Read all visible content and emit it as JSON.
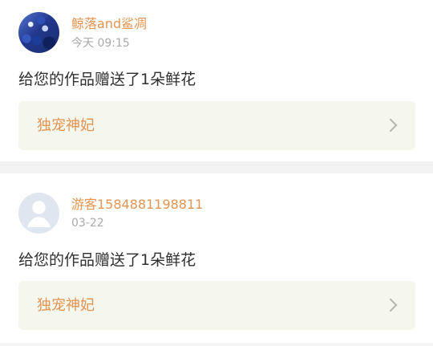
{
  "items": [
    {
      "username": "鲸落and鲨凋",
      "time": "今天 09:15",
      "message": "给您的作品赠送了1朵鲜花",
      "work_title": "独宠神妃",
      "avatar_icon": "user-photo-avatar",
      "arrow_icon": "chevron-right"
    },
    {
      "username": "游客1584881198811",
      "time": "03-22",
      "message": "给您的作品赠送了1朵鲜花",
      "work_title": "独宠神妃",
      "avatar_icon": "default-user-avatar",
      "arrow_icon": "chevron-right"
    }
  ]
}
